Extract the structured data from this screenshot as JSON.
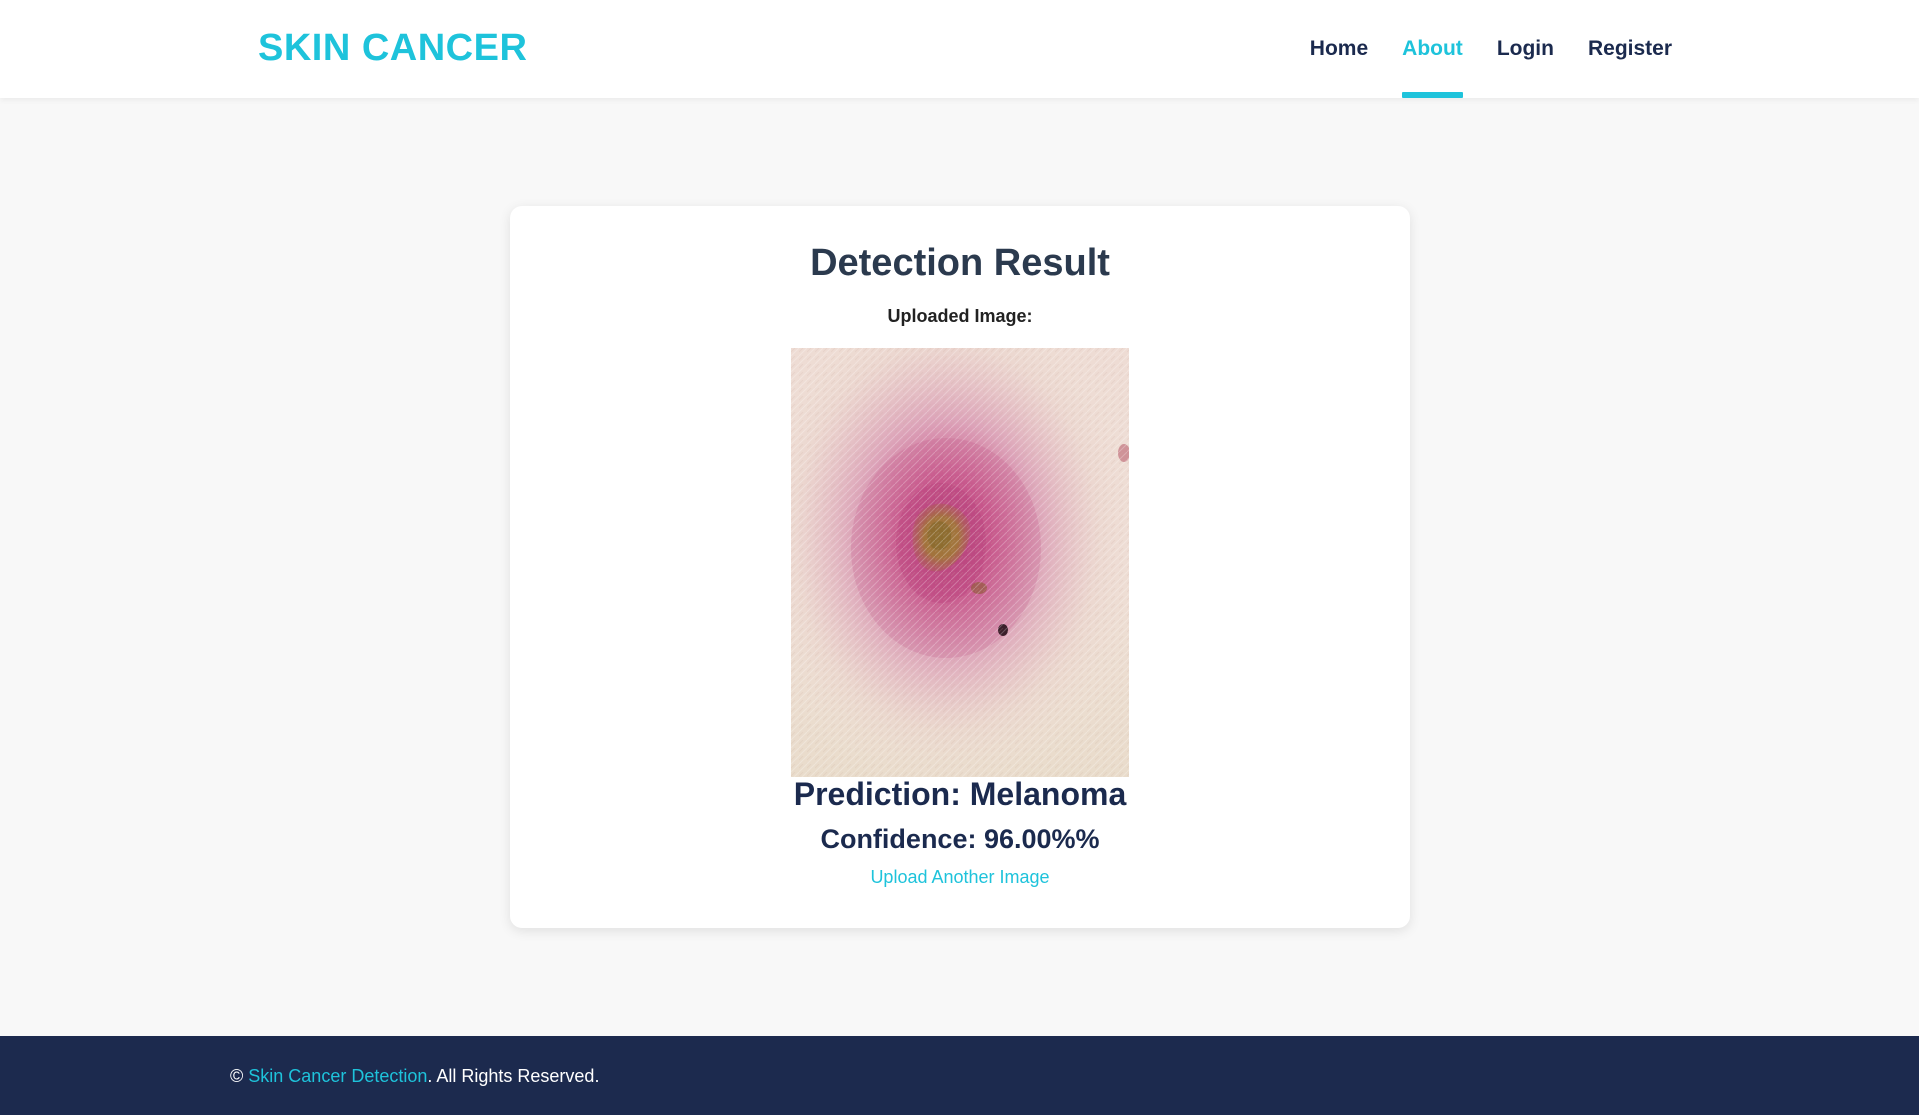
{
  "header": {
    "brand": "SKIN CANCER",
    "nav": [
      {
        "label": "Home",
        "active": false
      },
      {
        "label": "About",
        "active": true
      },
      {
        "label": "Login",
        "active": false
      },
      {
        "label": "Register",
        "active": false
      }
    ]
  },
  "result": {
    "title": "Detection Result",
    "uploaded_label": "Uploaded Image:",
    "prediction": "Prediction: Melanoma",
    "confidence": "Confidence: 96.00%%",
    "upload_another": "Upload Another Image"
  },
  "footer": {
    "copyright_symbol": "©",
    "link_text": "Skin Cancer Detection",
    "suffix": ". All Rights Reserved."
  },
  "colors": {
    "accent": "#1ec3db",
    "navy": "#1b2a4e",
    "footer_bg": "#1c2a4e",
    "page_bg": "#f8f8f8"
  }
}
